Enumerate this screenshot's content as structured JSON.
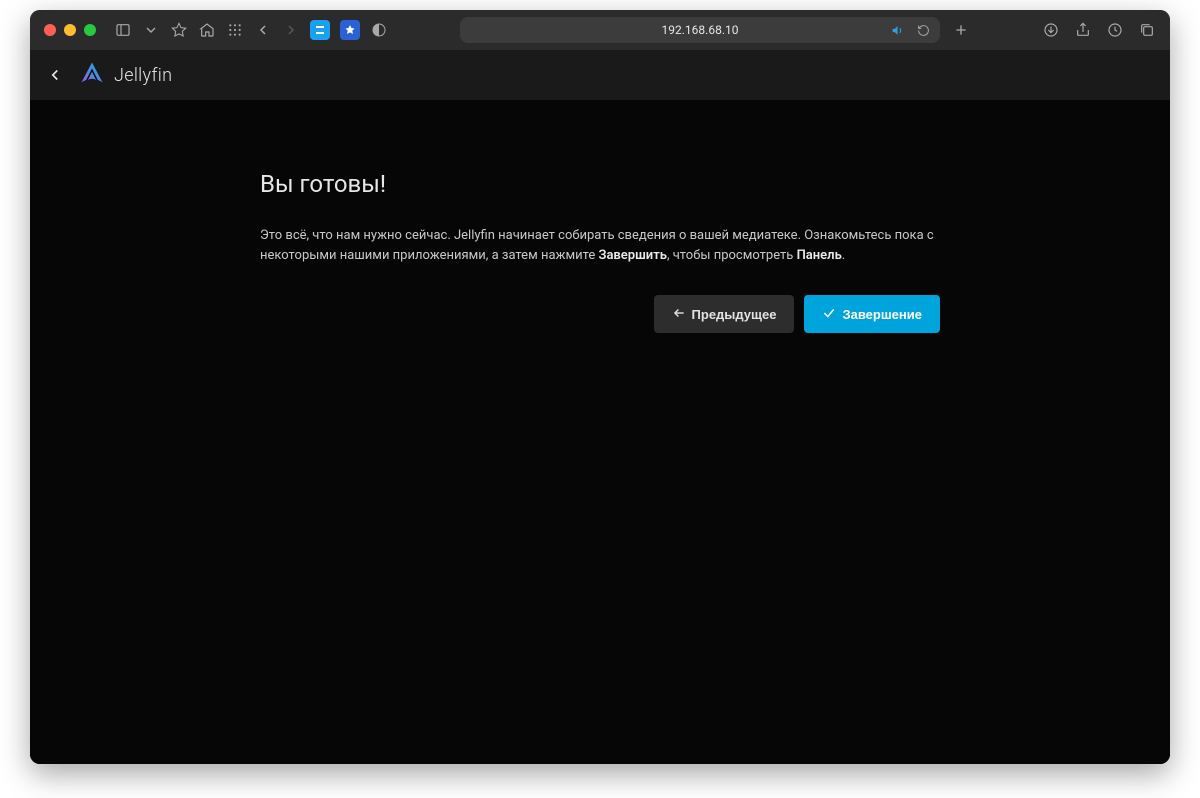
{
  "browser": {
    "url": "192.168.68.10"
  },
  "header": {
    "brand": "Jellyfin"
  },
  "wizard": {
    "title": "Вы готовы!",
    "para_part1": "Это всё, что нам нужно сейчас. Jellyfin начинает собирать сведения о вашей медиатеке. Ознакомьтесь пока с некоторыми нашими приложениями, а затем нажмите ",
    "para_bold1": "Завершить",
    "para_part2": ", чтобы просмотреть ",
    "para_bold2": "Панель",
    "para_part3": ".",
    "previous_label": "Предыдущее",
    "finish_label": "Завершение"
  }
}
